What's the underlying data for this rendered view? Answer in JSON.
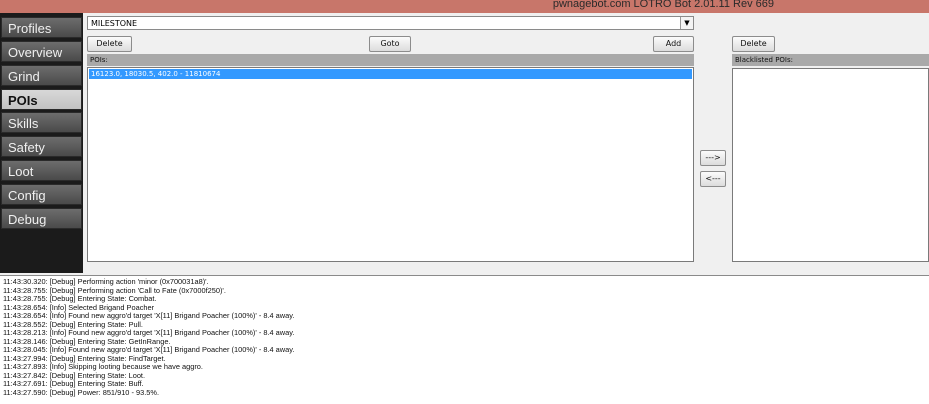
{
  "window": {
    "title": "pwnagebot.com LOTRO Bot 2.01.11 Rev 669"
  },
  "sidebar": {
    "items": [
      {
        "label": "Profiles",
        "active": false
      },
      {
        "label": "Overview",
        "active": false
      },
      {
        "label": "Grind",
        "active": false
      },
      {
        "label": "POIs",
        "active": true
      },
      {
        "label": "Skills",
        "active": false
      },
      {
        "label": "Safety",
        "active": false
      },
      {
        "label": "Loot",
        "active": false
      },
      {
        "label": "Config",
        "active": false
      },
      {
        "label": "Debug",
        "active": false
      }
    ]
  },
  "poi": {
    "selected_type": "MILESTONE",
    "delete_label": "Delete",
    "goto_label": "Goto",
    "add_label": "Add",
    "list_header": "POIs:",
    "items": [
      "16123.0, 18030.5, 402.0 - 11810674"
    ]
  },
  "blacklist": {
    "delete_label": "Delete",
    "list_header": "Blacklisted POIs:",
    "move_right_label": "--->",
    "move_left_label": "<---"
  },
  "log": {
    "lines": [
      "11:43:30.320: [Debug] Performing action 'minor (0x700031a8)'.",
      "11:43:28.755: [Debug] Performing action 'Call to Fate (0x7000f250)'.",
      "11:43:28.755: [Debug] Entering State: Combat.",
      "11:43:28.654: [Info] Selected Brigand Poacher",
      "11:43:28.654: [Info] Found new aggro'd target 'X[11] Brigand Poacher (100%)' - 8.4 away.",
      "11:43:28.552: [Debug] Entering State: Pull.",
      "11:43:28.213: [Info] Found new aggro'd target 'X[11] Brigand Poacher (100%)' - 8.4 away.",
      "11:43:28.146: [Debug] Entering State: GetInRange.",
      "11:43:28.045: [Info] Found new aggro'd target 'X[11] Brigand Poacher (100%)' - 8.4 away.",
      "11:43:27.994: [Debug] Entering State: FindTarget.",
      "11:43:27.893: [Info] Skipping looting because we have aggro.",
      "11:43:27.842: [Debug] Entering State: Loot.",
      "11:43:27.691: [Debug] Entering State: Buff.",
      "11:43:27.590: [Debug] Power: 851/910 - 93.5%."
    ]
  }
}
